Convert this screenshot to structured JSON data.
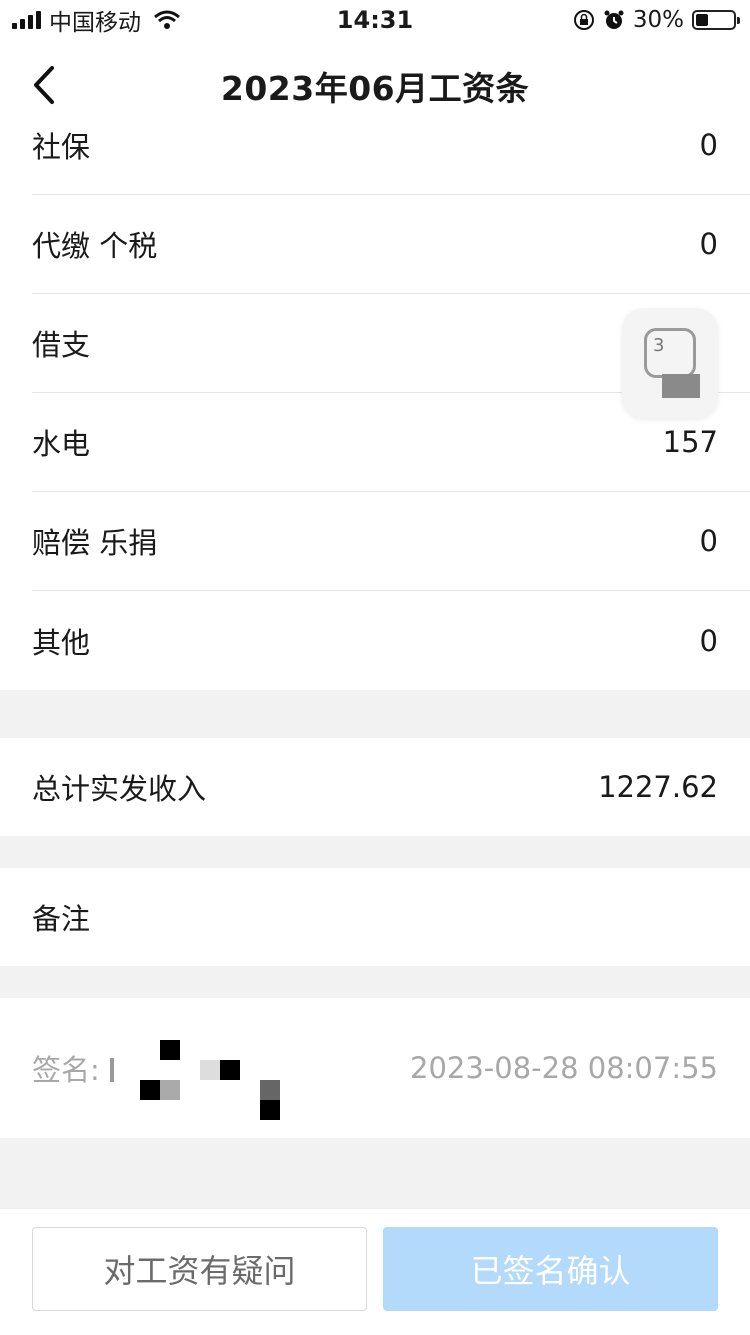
{
  "status_bar": {
    "carrier": "中国移动",
    "time": "14:31",
    "battery_percent": "30%",
    "battery_level": 0.3
  },
  "nav": {
    "title": "2023年06月工资条",
    "back_icon": "chevron-left-icon"
  },
  "deductions": [
    {
      "label": "社保",
      "value": "0"
    },
    {
      "label": "代缴 个税",
      "value": "0"
    },
    {
      "label": "借支",
      "value": ""
    },
    {
      "label": "水电",
      "value": "157"
    },
    {
      "label": "赔偿 乐捐",
      "value": "0"
    },
    {
      "label": "其他",
      "value": "0"
    }
  ],
  "total": {
    "label": "总计实发收入",
    "value": "1227.62"
  },
  "remark": {
    "label": "备注",
    "value": ""
  },
  "signature": {
    "label": "签名:",
    "datetime": "2023-08-28 08:07:55"
  },
  "floating_bubble": {
    "text": "3"
  },
  "buttons": {
    "question": "对工资有疑问",
    "confirm": "已签名确认"
  },
  "colors": {
    "confirm_bg": "#b3d9fb",
    "gap_bg": "#f2f2f3",
    "muted_text": "#a8a8a8"
  }
}
